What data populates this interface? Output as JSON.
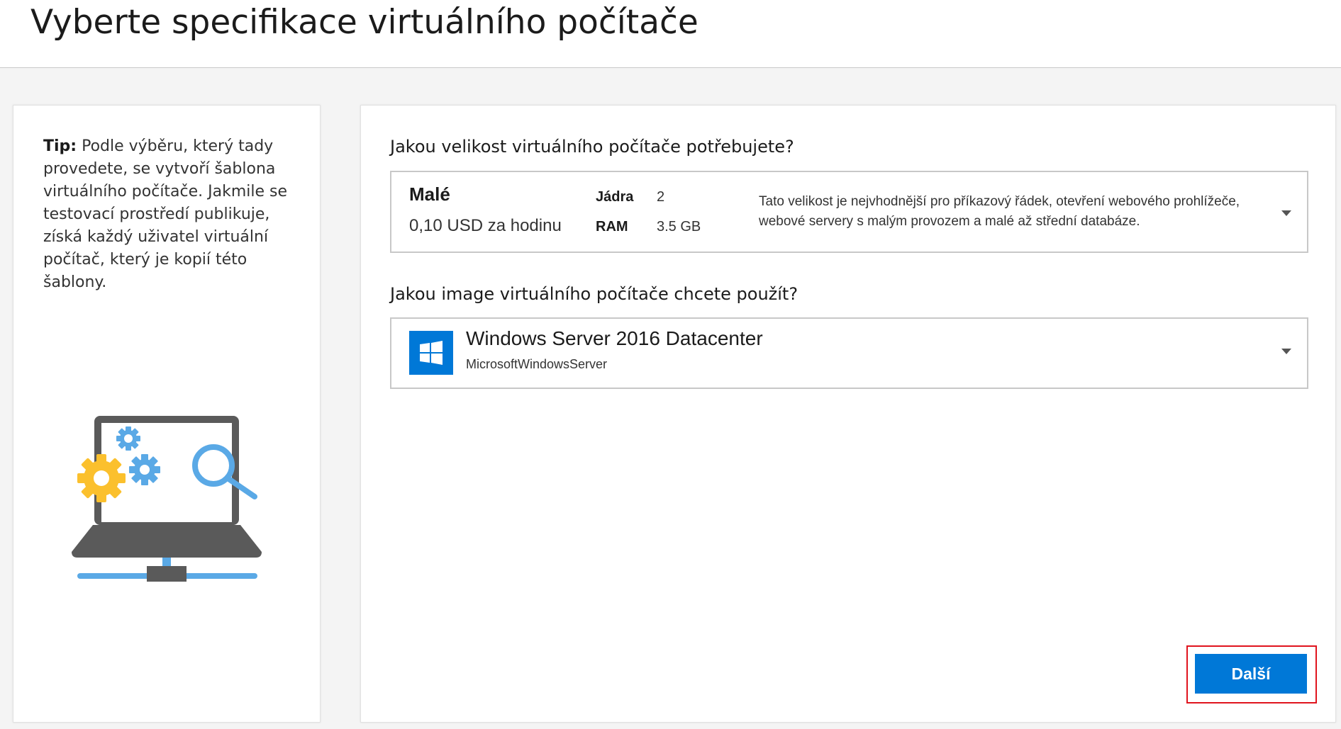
{
  "page": {
    "title": "Vyberte specifikace virtuálního počítače"
  },
  "tip": {
    "label": "Tip:",
    "text": " Podle výběru, který tady provedete, se vytvoří šablona virtuálního počítače. Jakmile se testovací prostředí publikuje, získá každý uživatel virtuální počítač, který je kopií této šablony."
  },
  "size_section": {
    "question": "Jakou velikost virtuálního počítače potřebujete?",
    "selected": {
      "name": "Malé",
      "price": "0,10 USD za hodinu",
      "cores_label": "Jádra",
      "cores_value": "2",
      "ram_label": "RAM",
      "ram_value": "3.5 GB",
      "description": "Tato velikost je nejvhodnější pro příkazový řádek, otevření webového prohlížeče, webové servery s malým provozem a malé až střední databáze."
    }
  },
  "image_section": {
    "question": "Jakou image virtuálního počítače chcete použít?",
    "selected": {
      "name": "Windows Server 2016 Datacenter",
      "publisher": "MicrosoftWindowsServer",
      "icon": "windows-logo-icon"
    }
  },
  "actions": {
    "next_label": "Další"
  },
  "colors": {
    "accent": "#0078d7",
    "highlight_border": "#e0141e",
    "gear_yellow": "#fbc02d",
    "illustration_blue": "#5aa9e6",
    "laptop_gray": "#5a5a5a"
  }
}
